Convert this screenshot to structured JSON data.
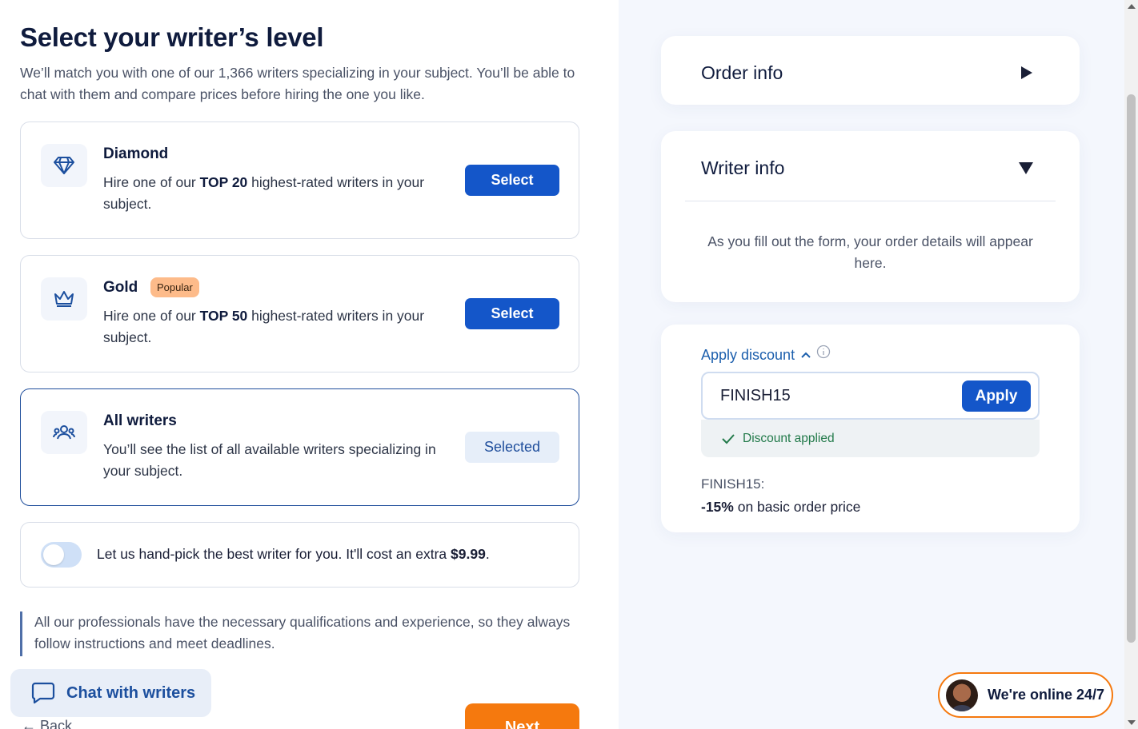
{
  "header": {
    "title": "Select your writer’s level",
    "subtitle": "We’ll match you with one of our 1,366 writers specializing in your subject. You’ll be able to chat with them and compare prices before hiring the one you like."
  },
  "levels": [
    {
      "name": "Diamond",
      "icon": "diamond-icon",
      "desc_pre": "Hire one of our ",
      "desc_bold": "TOP 20",
      "desc_post": " highest-rated writers in your subject.",
      "button": "Select"
    },
    {
      "name": "Gold",
      "badge": "Popular",
      "icon": "crown-icon",
      "desc_pre": "Hire one of our ",
      "desc_bold": "TOP 50",
      "desc_post": " highest-rated writers in your subject.",
      "button": "Select"
    },
    {
      "name": "All writers",
      "icon": "users-icon",
      "desc": "You’ll see the list of all available writers specializing in your subject.",
      "button": "Selected"
    }
  ],
  "handpick": {
    "text": "Let us hand-pick the best writer for you. It'll cost an extra ",
    "price": "$9.99",
    "suffix": ".",
    "enabled": false
  },
  "note": "All our professionals have the necessary qualifications and experience, so they always follow instructions and meet deadlines.",
  "chat_button": "Chat with writers",
  "back_label": "Back",
  "next_label": "Next",
  "sidebar": {
    "order_info": "Order info",
    "writer_info": "Writer info",
    "writer_info_empty": "As you fill out the form, your order details will appear here.",
    "discount": {
      "toggle_label": "Apply discount",
      "code_value": "FINISH15",
      "apply_label": "Apply",
      "status": "Discount applied",
      "code_label": "FINISH15:",
      "desc_bold": "-15%",
      "desc_rest": " on basic order price"
    }
  },
  "online_widget": "We're online 24/7",
  "colors": {
    "primary": "#1456c9",
    "accent_orange": "#f5790e",
    "success": "#227a4a",
    "badge": "#fdbb8a"
  }
}
